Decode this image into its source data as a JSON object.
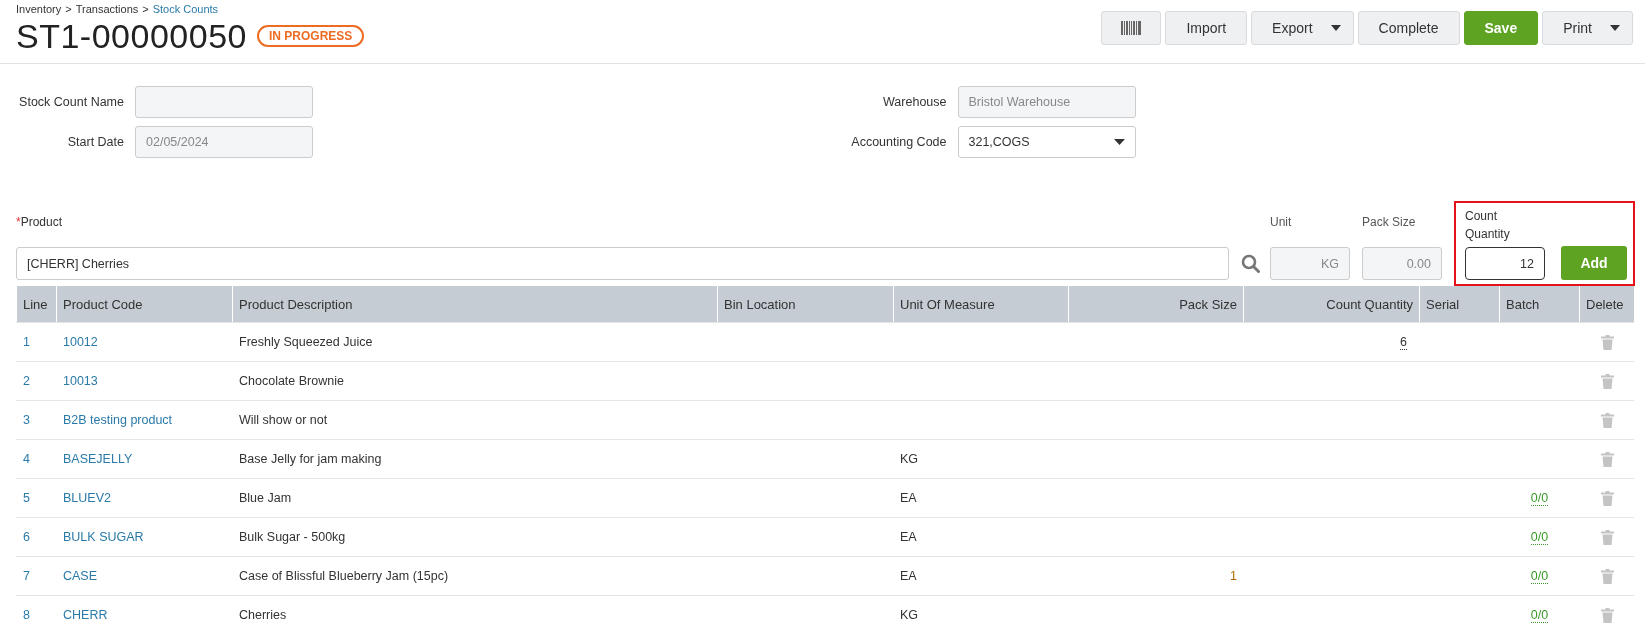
{
  "breadcrumb": {
    "separator": ">",
    "items": [
      {
        "label": "Inventory",
        "current": false
      },
      {
        "label": "Transactions",
        "current": false
      },
      {
        "label": "Stock Counts",
        "current": true
      }
    ]
  },
  "title": "ST1-00000050",
  "status": "IN PROGRESS",
  "toolbar": [
    {
      "kind": "icon"
    },
    {
      "kind": "plain",
      "label": "Import"
    },
    {
      "kind": "dropdown",
      "label": "Export"
    },
    {
      "kind": "plain",
      "label": "Complete"
    },
    {
      "kind": "primary",
      "label": "Save"
    },
    {
      "kind": "dropdown",
      "label": "Print"
    }
  ],
  "form_left": [
    {
      "label": "Stock Count Name",
      "kind": "text"
    },
    {
      "label": "Start Date",
      "kind": "text",
      "value": "02/05/2024"
    }
  ],
  "form_right": [
    {
      "label": "Warehouse",
      "kind": "text",
      "value": "Bristol Warehouse"
    },
    {
      "label": "Accounting Code",
      "kind": "select",
      "value": "321,COGS"
    }
  ],
  "product_entry": {
    "required_mark": "*",
    "label": "Product",
    "value": "[CHERR] Cherries",
    "unit_label": "Unit",
    "unit": "KG",
    "pack_size_label": "Pack Size",
    "pack_size": "0.00",
    "count_label": "Count Quantity",
    "count": "12",
    "add": "Add"
  },
  "table": {
    "columns": [
      "Line",
      "Product Code",
      "Product Description",
      "Bin Location",
      "Unit Of Measure",
      "Pack Size",
      "Count Quantity",
      "Serial",
      "Batch",
      "Delete"
    ],
    "rows": [
      {
        "line": "1",
        "code": "10012",
        "description": "Freshly Squeezed Juice",
        "count_quantity": "6"
      },
      {
        "line": "2",
        "code": "10013",
        "description": "Chocolate Brownie"
      },
      {
        "line": "3",
        "code": "B2B testing product",
        "description": "Will show or not"
      },
      {
        "line": "4",
        "code": "BASEJELLY",
        "description": "Base Jelly for jam making",
        "uom": "KG"
      },
      {
        "line": "5",
        "code": "BLUEV2",
        "description": "Blue Jam",
        "uom": "EA",
        "batch": "0/0"
      },
      {
        "line": "6",
        "code": "BULK SUGAR",
        "description": "Bulk Sugar - 500kg",
        "uom": "EA",
        "batch": "0/0"
      },
      {
        "line": "7",
        "code": "CASE",
        "description": "Case of Blissful Blueberry Jam (15pc)",
        "uom": "EA",
        "pack_size": "1",
        "batch": "0/0"
      },
      {
        "line": "8",
        "code": "CHERR",
        "description": "Cherries",
        "uom": "KG",
        "batch": "0/0"
      }
    ]
  }
}
